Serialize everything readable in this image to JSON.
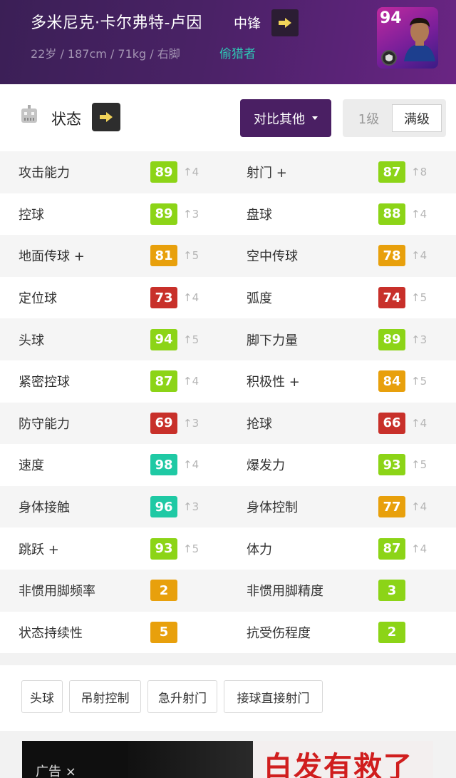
{
  "header": {
    "player_name": "多米尼克·卡尔弗特-卢因",
    "position": "中锋",
    "info": "22岁 / 187cm / 71kg / 右脚",
    "play_style": "偷猎者",
    "card_rating": "94"
  },
  "toolbar": {
    "status_title": "状态",
    "compare_label": "对比其他",
    "level_1": "1级",
    "level_max": "满级"
  },
  "stats": [
    {
      "left": {
        "label": "攻击能力",
        "value": "89",
        "inc": "↑4",
        "color": "#8cd417"
      },
      "right": {
        "label": "射门 +",
        "value": "87",
        "inc": "↑8",
        "color": "#8cd417"
      }
    },
    {
      "left": {
        "label": "控球",
        "value": "89",
        "inc": "↑3",
        "color": "#8cd417"
      },
      "right": {
        "label": "盘球",
        "value": "88",
        "inc": "↑4",
        "color": "#8cd417"
      }
    },
    {
      "left": {
        "label": "地面传球 +",
        "value": "81",
        "inc": "↑5",
        "color": "#e8a00c"
      },
      "right": {
        "label": "空中传球",
        "value": "78",
        "inc": "↑4",
        "color": "#e8a00c"
      }
    },
    {
      "left": {
        "label": "定位球",
        "value": "73",
        "inc": "↑4",
        "color": "#c8302a"
      },
      "right": {
        "label": "弧度",
        "value": "74",
        "inc": "↑5",
        "color": "#c8302a"
      }
    },
    {
      "left": {
        "label": "头球",
        "value": "94",
        "inc": "↑5",
        "color": "#8cd417"
      },
      "right": {
        "label": "脚下力量",
        "value": "89",
        "inc": "↑3",
        "color": "#8cd417"
      }
    },
    {
      "left": {
        "label": "紧密控球",
        "value": "87",
        "inc": "↑4",
        "color": "#8cd417"
      },
      "right": {
        "label": "积极性 +",
        "value": "84",
        "inc": "↑5",
        "color": "#e8a00c"
      }
    },
    {
      "left": {
        "label": "防守能力",
        "value": "69",
        "inc": "↑3",
        "color": "#c8302a"
      },
      "right": {
        "label": "抢球",
        "value": "66",
        "inc": "↑4",
        "color": "#c8302a"
      }
    },
    {
      "left": {
        "label": "速度",
        "value": "98",
        "inc": "↑4",
        "color": "#1fc9a4"
      },
      "right": {
        "label": "爆发力",
        "value": "93",
        "inc": "↑5",
        "color": "#8cd417"
      }
    },
    {
      "left": {
        "label": "身体接触",
        "value": "96",
        "inc": "↑3",
        "color": "#1fc9a4"
      },
      "right": {
        "label": "身体控制",
        "value": "77",
        "inc": "↑4",
        "color": "#e8a00c"
      }
    },
    {
      "left": {
        "label": "跳跃 +",
        "value": "93",
        "inc": "↑5",
        "color": "#8cd417"
      },
      "right": {
        "label": "体力",
        "value": "87",
        "inc": "↑4",
        "color": "#8cd417"
      }
    },
    {
      "left": {
        "label": "非惯用脚频率",
        "value": "2",
        "inc": "",
        "color": "#e8a00c"
      },
      "right": {
        "label": "非惯用脚精度",
        "value": "3",
        "inc": "",
        "color": "#8cd417"
      }
    },
    {
      "left": {
        "label": "状态持续性",
        "value": "5",
        "inc": "",
        "color": "#e8a00c"
      },
      "right": {
        "label": "抗受伤程度",
        "value": "2",
        "inc": "",
        "color": "#8cd417"
      }
    }
  ],
  "skills": [
    "头球",
    "吊射控制",
    "急升射门",
    "接球直接射门"
  ],
  "ad": {
    "label": "广告 ×",
    "text": "白发有救了"
  }
}
